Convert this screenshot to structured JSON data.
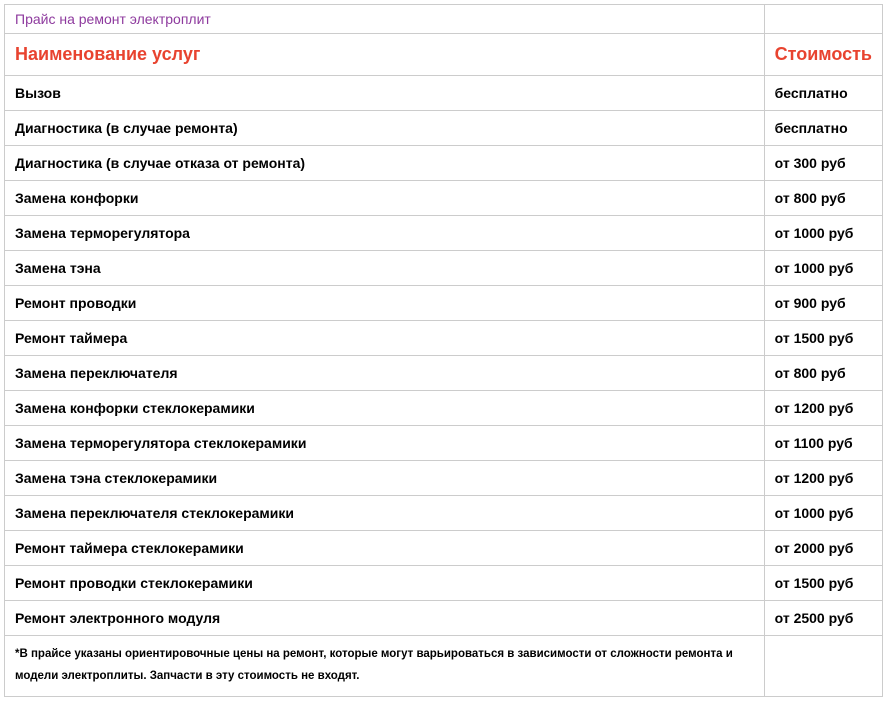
{
  "title": "Прайс на ремонт электроплит",
  "headers": {
    "service": "Наименование услуг",
    "price": "Стоимость"
  },
  "rows": [
    {
      "service": "Вызов",
      "price": "бесплатно"
    },
    {
      "service": "Диагностика (в случае ремонта)",
      "price": "бесплатно"
    },
    {
      "service": "Диагностика (в случае отказа от ремонта)",
      "price": "от 300 руб"
    },
    {
      "service": "Замена конфорки",
      "price": "от 800 руб"
    },
    {
      "service": "Замена терморегулятора",
      "price": "от 1000 руб"
    },
    {
      "service": "Замена тэна",
      "price": "от 1000 руб"
    },
    {
      "service": "Ремонт проводки",
      "price": "от 900 руб"
    },
    {
      "service": "Ремонт таймера",
      "price": "от 1500 руб"
    },
    {
      "service": "Замена переключателя",
      "price": "от 800 руб"
    },
    {
      "service": "Замена конфорки стеклокерамики",
      "price": "от 1200 руб"
    },
    {
      "service": "Замена терморегулятора стеклокерамики",
      "price": "от 1100 руб"
    },
    {
      "service": "Замена тэна стеклокерамики",
      "price": "от 1200 руб"
    },
    {
      "service": "Замена переключателя стеклокерамики",
      "price": "от 1000 руб"
    },
    {
      "service": "Ремонт таймера стеклокерамики",
      "price": "от 2000 руб"
    },
    {
      "service": "Ремонт проводки стеклокерамики",
      "price": "от 1500 руб"
    },
    {
      "service": "Ремонт электронного модуля",
      "price": "от 2500 руб"
    }
  ],
  "footnote": "*В прайсе указаны ориентировочные цены на ремонт, которые могут варьироваться в зависимости от сложности ремонта и модели электроплиты. Запчасти в эту стоимость не входят."
}
